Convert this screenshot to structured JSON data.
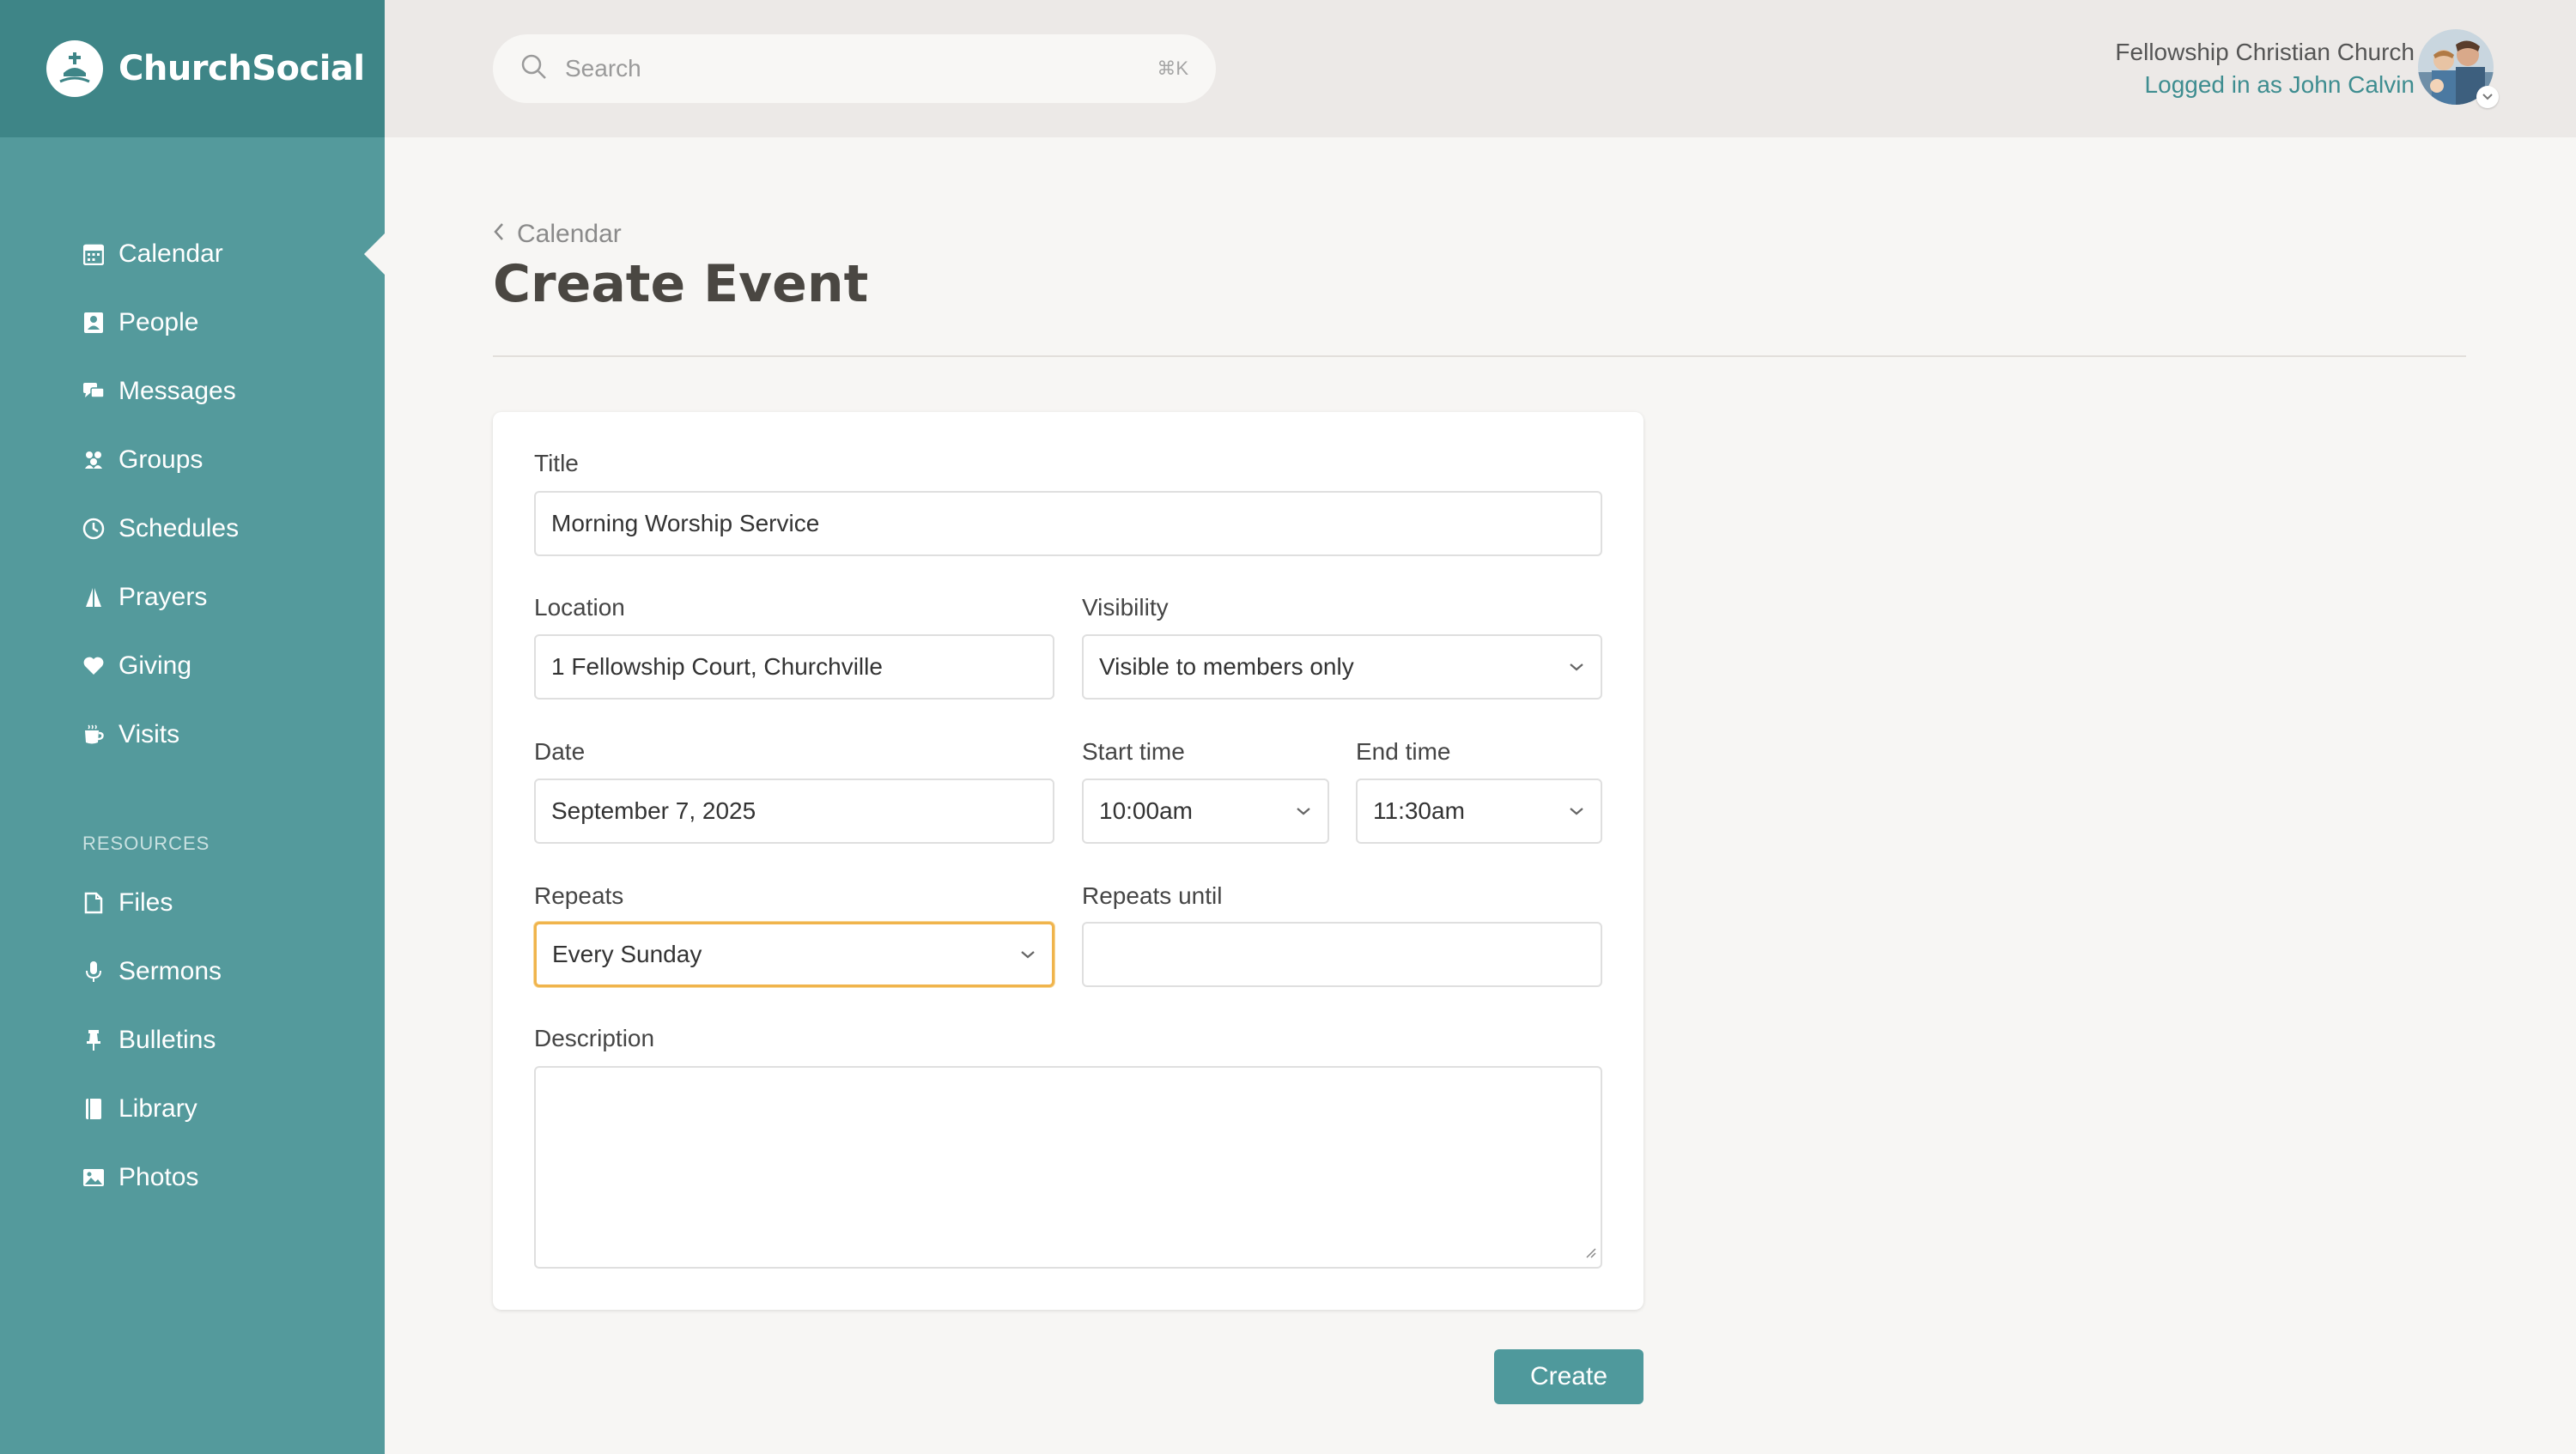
{
  "brand": {
    "name": "ChurchSocial"
  },
  "sidebar": {
    "items": [
      {
        "label": "Calendar",
        "icon": "calendar-icon",
        "active": true
      },
      {
        "label": "People",
        "icon": "person-icon"
      },
      {
        "label": "Messages",
        "icon": "chat-icon"
      },
      {
        "label": "Groups",
        "icon": "groups-icon"
      },
      {
        "label": "Schedules",
        "icon": "clock-icon"
      },
      {
        "label": "Prayers",
        "icon": "praying-hands-icon"
      },
      {
        "label": "Giving",
        "icon": "heart-icon"
      },
      {
        "label": "Visits",
        "icon": "coffee-cup-icon"
      }
    ],
    "resources_heading": "RESOURCES",
    "resources": [
      {
        "label": "Files",
        "icon": "file-icon"
      },
      {
        "label": "Sermons",
        "icon": "microphone-icon"
      },
      {
        "label": "Bulletins",
        "icon": "pin-icon"
      },
      {
        "label": "Library",
        "icon": "book-icon"
      },
      {
        "label": "Photos",
        "icon": "photo-icon"
      }
    ]
  },
  "header": {
    "search_placeholder": "Search",
    "search_shortcut": "⌘K",
    "church_name": "Fellowship Christian Church",
    "logged_in_text": "Logged in as John Calvin"
  },
  "page": {
    "breadcrumb": "Calendar",
    "title": "Create Event"
  },
  "form": {
    "title_label": "Title",
    "title_value": "Morning Worship Service",
    "location_label": "Location",
    "location_value": "1 Fellowship Court, Churchville",
    "visibility_label": "Visibility",
    "visibility_value": "Visible to members only",
    "date_label": "Date",
    "date_value": "September 7, 2025",
    "start_label": "Start time",
    "start_value": "10:00am",
    "end_label": "End time",
    "end_value": "11:30am",
    "repeats_label": "Repeats",
    "repeats_value": "Every Sunday",
    "repeats_until_label": "Repeats until",
    "repeats_until_value": "",
    "description_label": "Description",
    "description_value": ""
  },
  "actions": {
    "create_label": "Create"
  },
  "colors": {
    "sidebar": "#549a9c",
    "brand_bar": "#3e8587",
    "accent": "#4f999c",
    "focus": "#f0b44c"
  }
}
